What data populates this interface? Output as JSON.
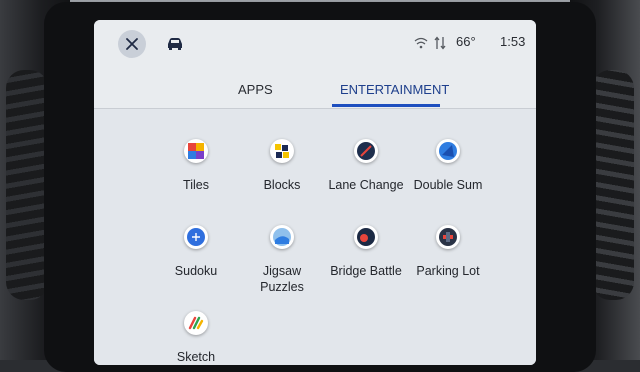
{
  "status_bar": {
    "close_icon": "close-icon",
    "vehicle_icon": "car-icon",
    "temperature": "66°",
    "time": "1:53"
  },
  "tabs": [
    {
      "label": "APPS",
      "selected": false
    },
    {
      "label": "ENTERTAINMENT",
      "selected": true
    }
  ],
  "apps": [
    {
      "label": "Tiles",
      "icon": "tiles-icon"
    },
    {
      "label": "Blocks",
      "icon": "blocks-icon"
    },
    {
      "label": "Lane Change",
      "icon": "lane-change-icon"
    },
    {
      "label": "Double Sum",
      "icon": "double-sum-icon"
    },
    {
      "label": "Sudoku",
      "icon": "sudoku-icon"
    },
    {
      "label": "Jigsaw\nPuzzles",
      "icon": "jigsaw-puzzles-icon"
    },
    {
      "label": "Bridge Battle",
      "icon": "bridge-battle-icon"
    },
    {
      "label": "Parking Lot",
      "icon": "parking-lot-icon"
    },
    {
      "label": "Sketch",
      "icon": "sketch-icon"
    }
  ],
  "colors": {
    "accent": "#1e4fbf",
    "screen_bg": "#e6e9ed"
  }
}
